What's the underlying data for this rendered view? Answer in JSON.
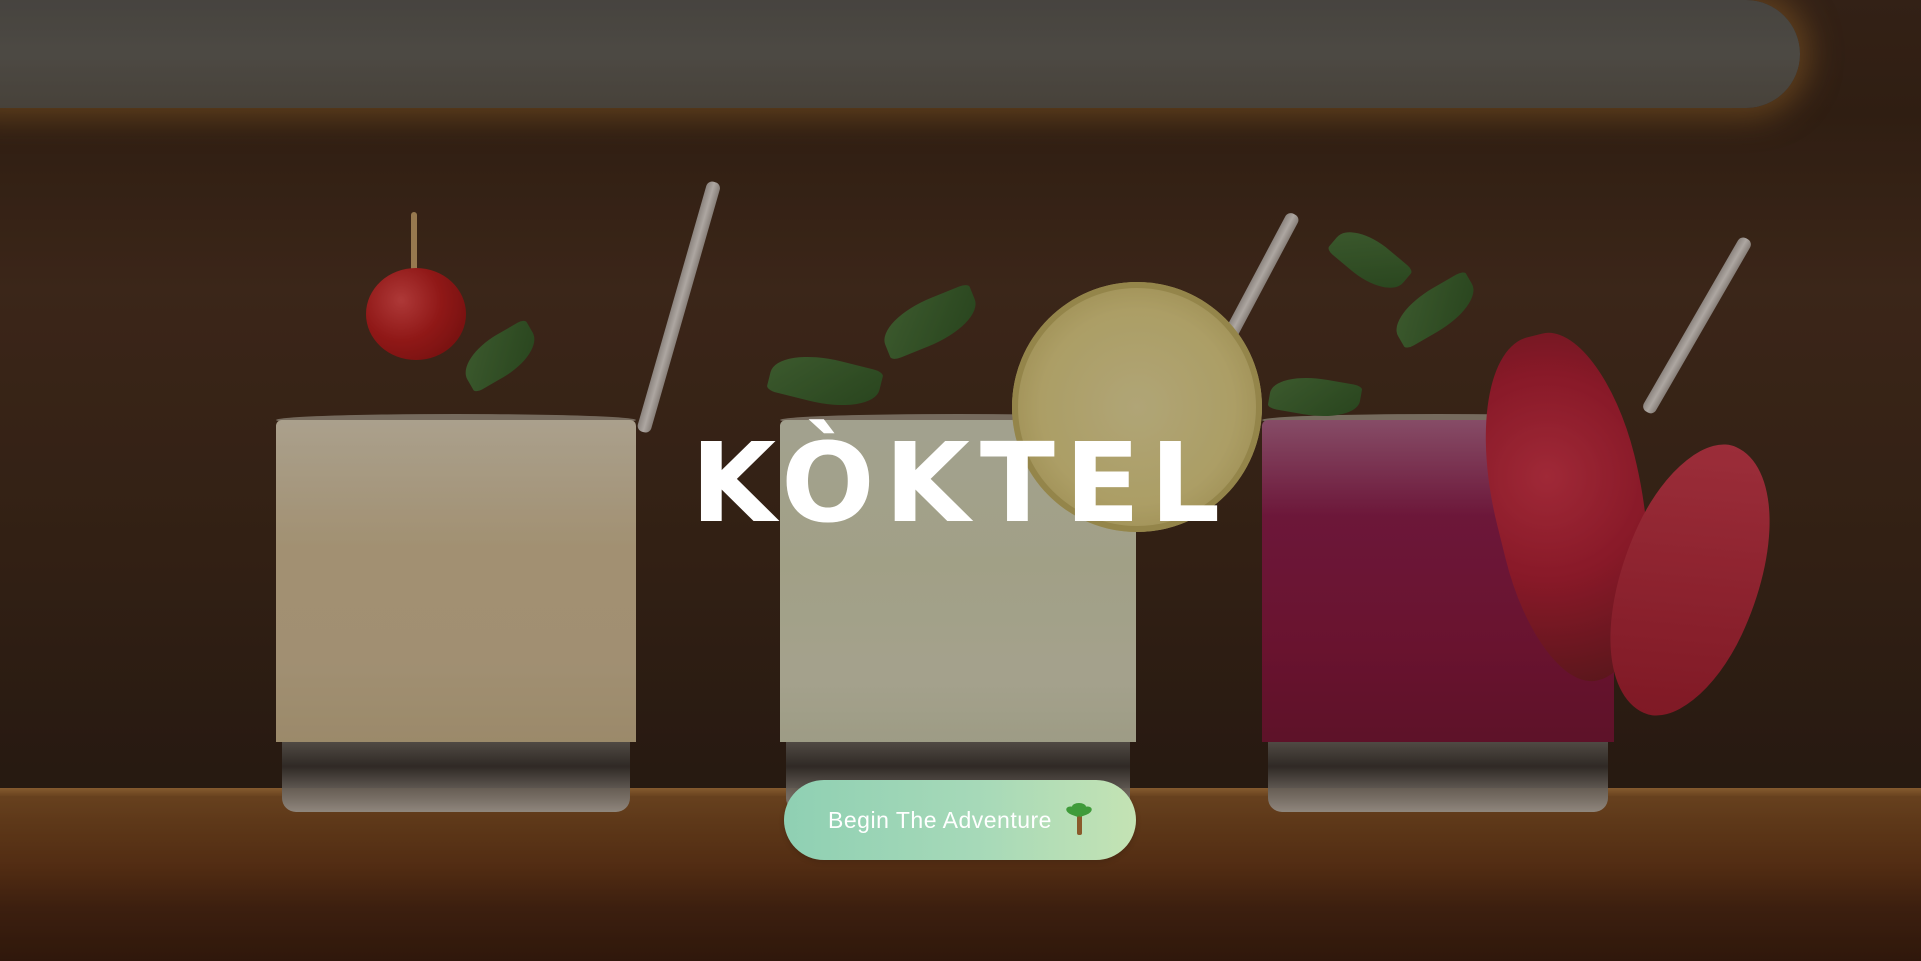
{
  "hero": {
    "title": "KÒKTEL",
    "background_image": "three-cocktails-on-bar-counter",
    "cta": {
      "label": "Begin The Adventure",
      "icon": "palm-tree-icon"
    }
  },
  "colors": {
    "title_text": "#ffffff",
    "cta_gradient_start": "#8fd0b3",
    "cta_gradient_end": "#c4e3b4",
    "cta_text": "#ffffff"
  }
}
